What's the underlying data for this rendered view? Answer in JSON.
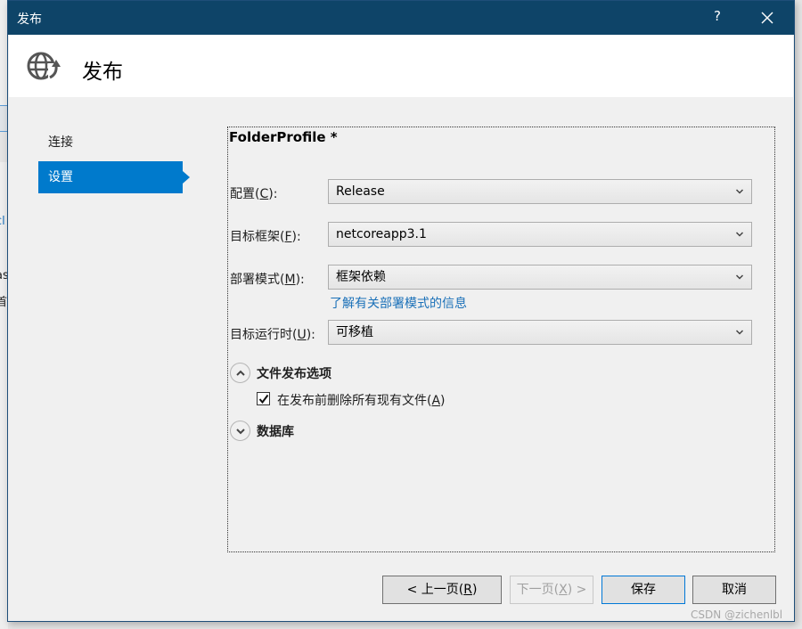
{
  "background": {
    "fragments": [
      "cl",
      "·",
      "as",
      "首"
    ]
  },
  "window": {
    "title": "发布",
    "help_label": "?",
    "close_icon": "close-icon"
  },
  "header": {
    "icon": "globe-publish-icon",
    "title": "发布"
  },
  "nav": {
    "items": [
      {
        "label": "连接",
        "selected": false
      },
      {
        "label": "设置",
        "selected": true
      }
    ]
  },
  "panel": {
    "profile_name": "FolderProfile *",
    "fields": [
      {
        "label": "配置(",
        "accesskey": "C",
        "label_end": "):",
        "value": "Release"
      },
      {
        "label": "目标框架(",
        "accesskey": "F",
        "label_end": "):",
        "value": "netcoreapp3.1"
      },
      {
        "label": "部署模式(",
        "accesskey": "M",
        "label_end": "):",
        "value": "框架依赖"
      },
      {
        "label": "目标运行时(",
        "accesskey": "U",
        "label_end": "):",
        "value": "可移植"
      }
    ],
    "deployment_mode_link": "了解有关部署模式的信息",
    "sections": [
      {
        "title": "文件发布选项",
        "expanded": true
      },
      {
        "title": "数据库",
        "expanded": false
      }
    ],
    "delete_existing_files": {
      "label": "在发布前删除所有现有文件(",
      "accesskey": "A",
      "label_end": ")",
      "checked": true
    }
  },
  "footer": {
    "prev": {
      "label": "< 上一页(",
      "accesskey": "R",
      "label_end": ")",
      "enabled": true
    },
    "next": {
      "label": "下一页(",
      "accesskey": "X",
      "label_end": ") >",
      "enabled": false
    },
    "save": {
      "label": "保存",
      "enabled": true
    },
    "cancel": {
      "label": "取消",
      "enabled": true
    }
  },
  "watermark": "CSDN @zichenlbl",
  "colors": {
    "titlebar": "#0e4468",
    "accent": "#007acc",
    "link": "#1a70b8"
  }
}
